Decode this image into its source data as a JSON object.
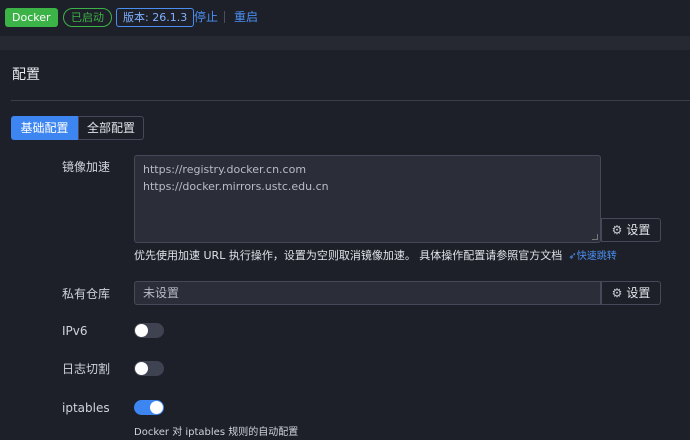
{
  "topbar": {
    "app_tag": "Docker",
    "status": "已启动",
    "version": "版本: 26.1.3",
    "stop_label": "停止",
    "restart_label": "重启"
  },
  "section": {
    "title": "配置"
  },
  "tabs": [
    {
      "label": "基础配置",
      "active": true
    },
    {
      "label": "全部配置",
      "active": false
    }
  ],
  "mirror": {
    "label": "镜像加速",
    "lines": [
      "https://registry.docker.cn.com",
      "https://docker.mirrors.ustc.edu.cn"
    ],
    "button_label": "设置",
    "helper": "优先使用加速 URL 执行操作，设置为空则取消镜像加速。 具体操作配置请参照官方文档",
    "jump_label": "快速跳转"
  },
  "registry": {
    "label": "私有仓库",
    "value": "未设置",
    "button_label": "设置"
  },
  "ipv6": {
    "label": "IPv6",
    "enabled": false
  },
  "log_rotate": {
    "label": "日志切割",
    "enabled": false
  },
  "iptables": {
    "label": "iptables",
    "enabled": true,
    "note": "Docker 对 iptables 规则的自动配置"
  },
  "colors": {
    "primary": "#3d86f2",
    "success": "#3bb346",
    "background": "#1e2029"
  }
}
